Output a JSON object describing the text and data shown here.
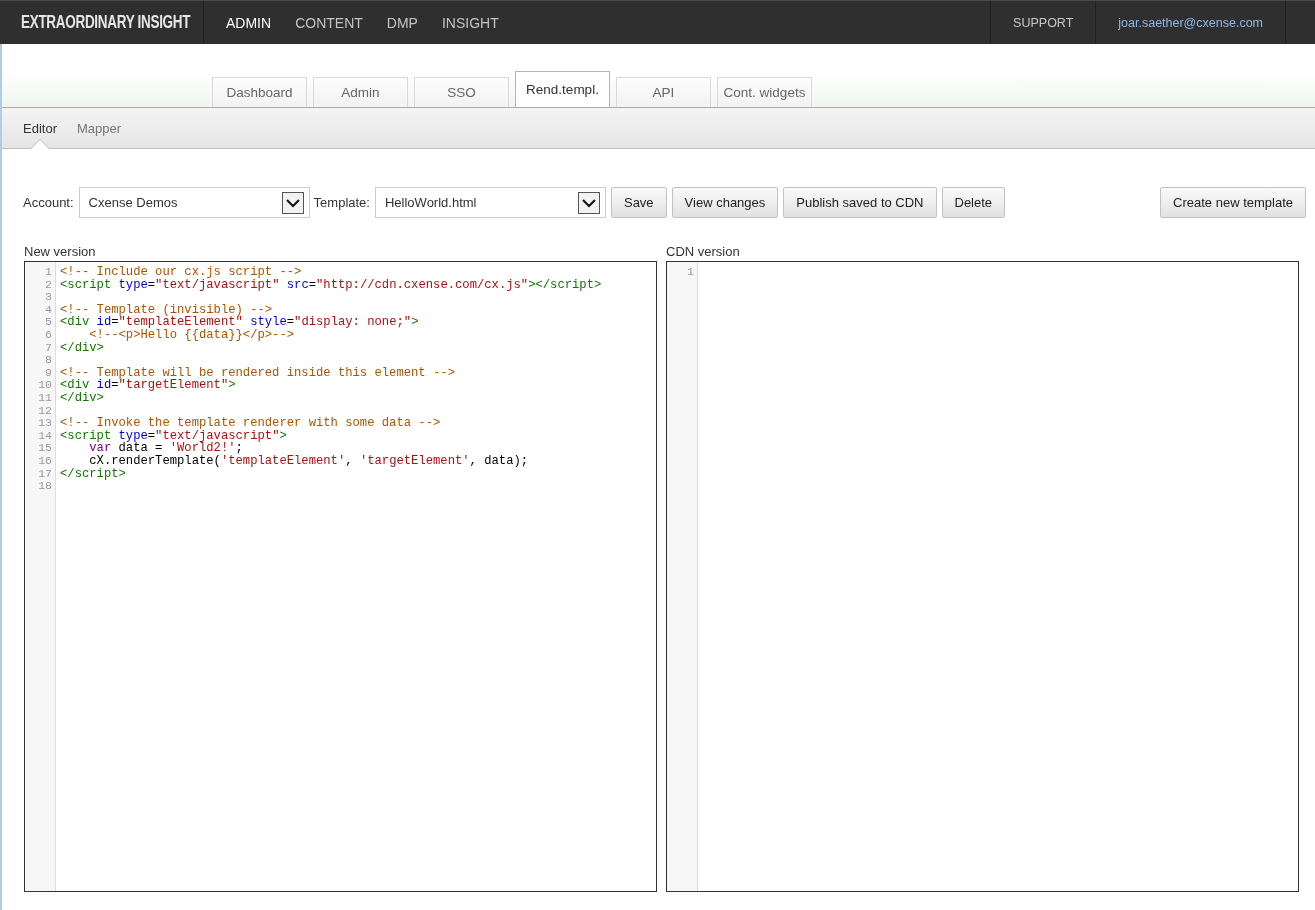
{
  "top_bar": {
    "logo": "EXTRAORDINARY INSIGHT",
    "nav": [
      {
        "label": "ADMIN",
        "selected": true
      },
      {
        "label": "CONTENT",
        "selected": false
      },
      {
        "label": "DMP",
        "selected": false
      },
      {
        "label": "INSIGHT",
        "selected": false
      }
    ],
    "links": [
      {
        "label": "SUPPORT",
        "kind": "menu"
      },
      {
        "label": "joar.saether@cxense.com",
        "kind": "user"
      }
    ]
  },
  "tabs": [
    {
      "label": "Dashboard",
      "selected": false
    },
    {
      "label": "Admin",
      "selected": false
    },
    {
      "label": "SSO",
      "selected": false
    },
    {
      "label": "Rend.templ.",
      "selected": true
    },
    {
      "label": "API",
      "selected": false
    },
    {
      "label": "Cont. widgets",
      "selected": false
    }
  ],
  "subtabs": [
    {
      "label": "Editor",
      "selected": true
    },
    {
      "label": "Mapper",
      "selected": false
    }
  ],
  "toolbar": {
    "selects": [
      {
        "label": "Account:",
        "value": "Cxense Demos"
      },
      {
        "label": "Template:",
        "value": "HelloWorld.html"
      }
    ],
    "buttons": [
      "Save",
      "View changes",
      "Publish saved to CDN",
      "Delete"
    ],
    "create_button": "Create new template"
  },
  "editors": [
    {
      "title": "New version",
      "lines": [
        {
          "number": "1",
          "tokens": [
            {
              "kind": "comment",
              "text": "<!-- Include our cx.js script -->"
            }
          ]
        },
        {
          "number": "2",
          "tokens": [
            {
              "kind": "tag",
              "text": "<script"
            },
            {
              "kind": "attribute",
              "text": " type"
            },
            {
              "kind": "plain",
              "text": "="
            },
            {
              "kind": "string",
              "text": "\"text/javascript\""
            },
            {
              "kind": "attribute",
              "text": " src"
            },
            {
              "kind": "plain",
              "text": "="
            },
            {
              "kind": "string",
              "text": "\"http://cdn.cxense.com/cx.js\""
            },
            {
              "kind": "tag",
              "text": "></script>"
            }
          ]
        },
        {
          "number": "3"
        },
        {
          "number": "4",
          "tokens": [
            {
              "kind": "comment",
              "text": "<!-- Template (invisible) -->"
            }
          ]
        },
        {
          "number": "5",
          "tokens": [
            {
              "kind": "tag",
              "text": "<div"
            },
            {
              "kind": "attribute",
              "text": " id"
            },
            {
              "kind": "plain",
              "text": "="
            },
            {
              "kind": "string",
              "text": "\"templateElement\""
            },
            {
              "kind": "attribute",
              "text": " style"
            },
            {
              "kind": "plain",
              "text": "="
            },
            {
              "kind": "string",
              "text": "\"display: none;\""
            },
            {
              "kind": "tag",
              "text": ">"
            }
          ]
        },
        {
          "number": "6",
          "tokens": [
            {
              "kind": "comment",
              "text": "    <!--<p>Hello {{data}}</p>-->"
            }
          ]
        },
        {
          "number": "7",
          "tokens": [
            {
              "kind": "tag",
              "text": "</div>"
            }
          ]
        },
        {
          "number": "8"
        },
        {
          "number": "9",
          "tokens": [
            {
              "kind": "comment",
              "text": "<!-- Template will be rendered inside this element -->"
            }
          ]
        },
        {
          "number": "10",
          "tokens": [
            {
              "kind": "tag",
              "text": "<div"
            },
            {
              "kind": "attribute",
              "text": " id"
            },
            {
              "kind": "plain",
              "text": "="
            },
            {
              "kind": "string",
              "text": "\"targetElement\""
            },
            {
              "kind": "tag",
              "text": ">"
            }
          ]
        },
        {
          "number": "11",
          "tokens": [
            {
              "kind": "tag",
              "text": "</div>"
            }
          ]
        },
        {
          "number": "12"
        },
        {
          "number": "13",
          "tokens": [
            {
              "kind": "comment",
              "text": "<!-- Invoke the template renderer with some data -->"
            }
          ]
        },
        {
          "number": "14",
          "tokens": [
            {
              "kind": "tag",
              "text": "<script"
            },
            {
              "kind": "attribute",
              "text": " type"
            },
            {
              "kind": "plain",
              "text": "="
            },
            {
              "kind": "string",
              "text": "\"text/javascript\""
            },
            {
              "kind": "tag",
              "text": ">"
            }
          ]
        },
        {
          "number": "15",
          "tokens": [
            {
              "kind": "keyword",
              "text": "    var"
            },
            {
              "kind": "plain",
              "text": " data = "
            },
            {
              "kind": "string",
              "text": "'World2!'"
            },
            {
              "kind": "plain",
              "text": ";"
            }
          ]
        },
        {
          "number": "16",
          "tokens": [
            {
              "kind": "plain",
              "text": "    cX.renderTemplate("
            },
            {
              "kind": "string",
              "text": "'templateElement'"
            },
            {
              "kind": "plain",
              "text": ", "
            },
            {
              "kind": "string",
              "text": "'targetElement'"
            },
            {
              "kind": "plain",
              "text": ", data);"
            }
          ]
        },
        {
          "number": "17",
          "tokens": [
            {
              "kind": "tag",
              "text": "</script>"
            }
          ]
        },
        {
          "number": "18"
        }
      ]
    },
    {
      "title": "CDN version",
      "lines": [
        {
          "number": "1"
        }
      ]
    }
  ]
}
